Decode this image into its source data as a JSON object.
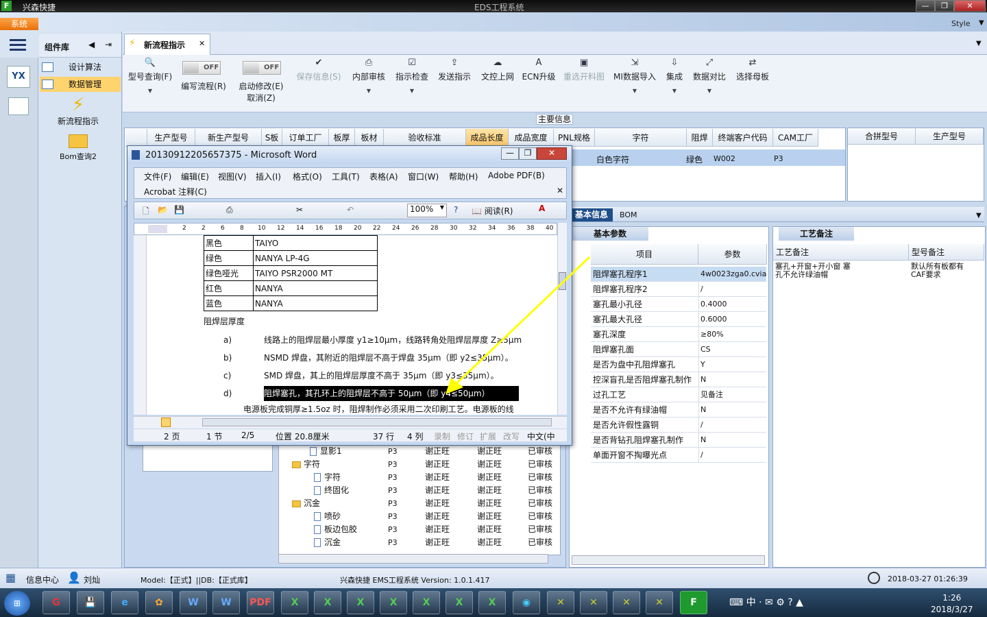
{
  "title_bar": {
    "app_name": "兴森快捷",
    "window_title": "EDS工程系统"
  },
  "menu": {
    "system_tab": "系统",
    "style_label": "Style"
  },
  "left_nav": {
    "panel_title": "组件库",
    "items": [
      {
        "label": "设计算法"
      },
      {
        "label": "数据管理"
      }
    ],
    "launchers": [
      {
        "label": "新流程指示"
      },
      {
        "label": "Bom查询2"
      }
    ]
  },
  "tab": {
    "label": "新流程指示"
  },
  "ribbon": {
    "query": "型号查询(F)",
    "write_flow": "编写流程(R)",
    "start_modify": "启动修改(E)",
    "cancel": "取消(Z)",
    "toggle_off": "OFF",
    "save": "保存信息(S)",
    "internal_review": "内部审核",
    "check": "指示检查",
    "send": "发送指示",
    "upload": "文控上网",
    "ecn": "ECN升级",
    "reselect": "重选开料图",
    "mi_import": "MI数据导入",
    "integrate": "集成",
    "compare": "数据对比",
    "select_master": "选择母板"
  },
  "main_info": {
    "title": "主要信息",
    "headers": [
      "生产型号",
      "新生产型号",
      "S板",
      "订单工厂",
      "板厚",
      "板材",
      "验收标准",
      "成品长度",
      "成品宽度",
      "PNL规格",
      "字符",
      "阻焊",
      "终端客户代码",
      "CAM工厂"
    ],
    "row": {
      "char": "白色字符",
      "mask": "绿色",
      "customer": "W002",
      "cam": "P3"
    },
    "right_headers": [
      "合拼型号",
      "生产型号"
    ]
  },
  "tree": {
    "rows": [
      {
        "name": "显影1",
        "f": "P3",
        "a": "谢正旺",
        "b": "谢正旺",
        "s": "已审核"
      },
      {
        "name": "字符",
        "f": "P3",
        "a": "谢正旺",
        "b": "谢正旺",
        "s": "已审核",
        "folder": true
      },
      {
        "name": "字符",
        "f": "P3",
        "a": "谢正旺",
        "b": "谢正旺",
        "s": "已审核"
      },
      {
        "name": "终固化",
        "f": "P3",
        "a": "谢正旺",
        "b": "谢正旺",
        "s": "已审核"
      },
      {
        "name": "沉金",
        "f": "P3",
        "a": "谢正旺",
        "b": "谢正旺",
        "s": "已审核",
        "folder": true
      },
      {
        "name": "喷砂",
        "f": "P3",
        "a": "谢正旺",
        "b": "谢正旺",
        "s": "已审核"
      },
      {
        "name": "板边包胶",
        "f": "P3",
        "a": "谢正旺",
        "b": "谢正旺",
        "s": "已审核"
      },
      {
        "name": "沉金",
        "f": "P3",
        "a": "谢正旺",
        "b": "谢正旺",
        "s": "已审核"
      }
    ]
  },
  "right_panel": {
    "tab_basic": "基本信息",
    "tab_bom": "BOM",
    "sub_basic": "基本参数",
    "col_item": "项目",
    "col_param": "参数",
    "sub_process": "工艺备注",
    "col_proc_note": "工艺备注",
    "col_model_note": "型号备注",
    "proc_note": "塞孔+开窗+开小窗 塞孔不允许绿油帽",
    "model_note": "默认所有板都有CAF要求",
    "rows": [
      {
        "k": "阻焊塞孔程序1",
        "v": "4w0023zga0.cvia"
      },
      {
        "k": "阻焊塞孔程序2",
        "v": "/"
      },
      {
        "k": "塞孔最小孔径",
        "v": "0.4000"
      },
      {
        "k": "塞孔最大孔径",
        "v": "0.6000"
      },
      {
        "k": "塞孔深度",
        "v": "≥80%"
      },
      {
        "k": "阻焊塞孔面",
        "v": "CS"
      },
      {
        "k": "是否为盘中孔阻焊塞孔",
        "v": "Y"
      },
      {
        "k": "控深盲孔是否阻焊塞孔制作",
        "v": "N"
      },
      {
        "k": "过孔工艺",
        "v": "见备注"
      },
      {
        "k": "是否不允许有绿油帽",
        "v": "N"
      },
      {
        "k": "是否允许假性露铜",
        "v": "/"
      },
      {
        "k": "是否背钻孔阻焊塞孔制作",
        "v": "N"
      },
      {
        "k": "单面开窗不掏曝光点",
        "v": "/"
      }
    ]
  },
  "word": {
    "title": "20130912205657375 - Microsoft Word",
    "menus": [
      "文件(F)",
      "编辑(E)",
      "视图(V)",
      "插入(I)",
      "格式(O)",
      "工具(T)",
      "表格(A)",
      "窗口(W)",
      "帮助(H)",
      "Adobe PDF(B)"
    ],
    "acrobat": "Acrobat 注释(C)",
    "zoom": "100%",
    "read_btn": "阅读(R)",
    "ruler": [
      "2",
      "2",
      "6",
      "8",
      "10",
      "12",
      "14",
      "16",
      "18",
      "20",
      "22",
      "24",
      "26",
      "28",
      "30",
      "32",
      "34",
      "36",
      "38",
      "40"
    ],
    "table": [
      [
        "黑色",
        "TAIYO"
      ],
      [
        "绿色",
        "NANYA  LP-4G"
      ],
      [
        "绿色哑光",
        "TAIYO    PSR2000 MT"
      ],
      [
        "红色",
        "NANYA"
      ],
      [
        "蓝色",
        "NANYA"
      ]
    ],
    "heading": "阻焊层厚度",
    "items": [
      {
        "m": "a)",
        "t": "线路上的阻焊层最小厚度 y1≥10μm，线路转角处阻焊层厚度 Z≥5μm"
      },
      {
        "m": "b)",
        "t": "NSMD 焊盘，其附近的阻焊层不高于焊盘 35μm（即 y2≤35μm）。"
      },
      {
        "m": "c)",
        "t": "SMD 焊盘，其上的阻焊层厚度不高于 35μm（即 y3≤35μm）。"
      },
      {
        "m": "d)",
        "t": "阻焊塞孔，其孔环上的阻焊层不高于 50μm（即 y4≤50μm）"
      }
    ],
    "para": "电源板完成铜厚≥1.5oz 时，阻焊制作必须采用二次印刷工艺。电源板的线",
    "status": {
      "page": "2 页",
      "section": "1 节",
      "pages": "2/5",
      "pos": "位置 20.8厘米",
      "line": "37 行",
      "col": "4 列",
      "rec": "录制",
      "trk": "修订",
      "ext": "扩展",
      "ovr": "改写",
      "lang": "中文(中"
    }
  },
  "status_bar": {
    "info_center": "信息中心",
    "user": "刘灿",
    "model": "Model:【正式】||DB:【正式库】",
    "version": "兴森快捷 EMS工程系统 Version: 1.0.1.417",
    "datetime": "2018-03-27 01:26:39"
  },
  "taskbar": {
    "time": "1:26",
    "date": "2018/3/27",
    "ime": "中"
  }
}
